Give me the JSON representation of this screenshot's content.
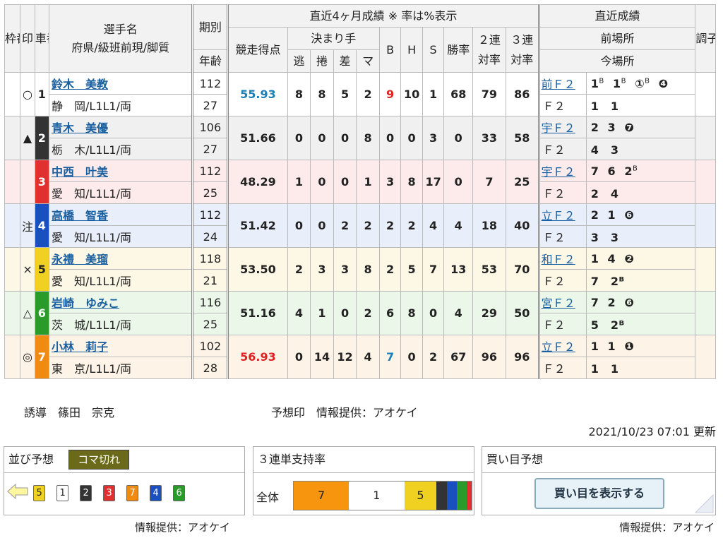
{
  "header": {
    "waku": "枠番",
    "shirushi": "印",
    "sha": "車番",
    "name1": "選手名",
    "name2": "府県/級班前現/脚質",
    "kibetsu": "期別",
    "nenrei": "年齢",
    "recent": "直近4ヶ月成績 ※ 率は%表示",
    "score": "競走得点",
    "kimari": "決まり手",
    "k_nige": "逃",
    "k_makuri": "捲",
    "k_sashi": "差",
    "k_ma": "マ",
    "b": "B",
    "h": "H",
    "s": "S",
    "win": "勝率",
    "ren2a": "２連",
    "ren2b": "対率",
    "ren3a": "３連",
    "ren3b": "対率",
    "latest": "直近成績",
    "prev": "前場所",
    "now": "今場所",
    "cho": "調子"
  },
  "riders": [
    {
      "waku": "1",
      "mark": "○",
      "name": "鈴木　美教",
      "pref": "静　岡/L1L1/両",
      "ki": "112",
      "age": "27",
      "score": "55.93",
      "nige": "8",
      "makuri": "8",
      "sashi": "5",
      "ma": "2",
      "b": "9",
      "h": "10",
      "s": "1",
      "win": "68",
      "r2": "79",
      "r3": "86",
      "prev_place": "前Ｆ２",
      "prev_res": [
        "1",
        "B",
        "1",
        "B",
        "①",
        "B",
        "❹"
      ],
      "now_place": "Ｆ２",
      "now_res": "1　1",
      "color": "#ffffff",
      "tcolor": "#222",
      "bg": "#ffffff"
    },
    {
      "waku": "2",
      "mark": "▲",
      "name": "青木　美優",
      "pref": "栃　木/L1L1/両",
      "ki": "106",
      "age": "27",
      "score": "51.66",
      "nige": "0",
      "makuri": "0",
      "sashi": "0",
      "ma": "8",
      "b": "0",
      "h": "0",
      "s": "3",
      "win": "0",
      "r2": "33",
      "r3": "58",
      "prev_place": "宇Ｆ２",
      "prev_res": [
        "2",
        "",
        "3",
        "",
        "❼",
        "",
        ""
      ],
      "now_place": "Ｆ２",
      "now_res": "4　3",
      "color": "#333333",
      "tcolor": "#fff",
      "bg": "#f0f0f0"
    },
    {
      "waku": "3",
      "mark": "",
      "name": "中西　叶美",
      "pref": "愛　知/L1L1/両",
      "ki": "112",
      "age": "25",
      "score": "48.29",
      "nige": "1",
      "makuri": "0",
      "sashi": "0",
      "ma": "1",
      "b": "3",
      "h": "8",
      "s": "17",
      "win": "0",
      "r2": "7",
      "r3": "25",
      "prev_place": "宇Ｆ２",
      "prev_res": [
        "7",
        "",
        "6",
        "",
        "2",
        "B",
        ""
      ],
      "now_place": "Ｆ２",
      "now_res": "2　4",
      "color": "#e03030",
      "tcolor": "#fff",
      "bg": "#fdeaea"
    },
    {
      "waku": "4",
      "mark": "注",
      "name": "高橋　智香",
      "pref": "愛　知/L1L1/両",
      "ki": "112",
      "age": "24",
      "score": "51.42",
      "nige": "0",
      "makuri": "0",
      "sashi": "2",
      "ma": "2",
      "b": "2",
      "h": "2",
      "s": "4",
      "win": "4",
      "r2": "18",
      "r3": "40",
      "prev_place": "立Ｆ２",
      "prev_res": [
        "2",
        "",
        "1",
        "",
        "❻",
        "",
        ""
      ],
      "now_place": "Ｆ２",
      "now_res": "3　3",
      "color": "#1a4fc0",
      "tcolor": "#fff",
      "bg": "#e8eefa"
    },
    {
      "waku": "5",
      "mark": "×",
      "name": "永禮　美瑠",
      "pref": "愛　知/L1L1/両",
      "ki": "118",
      "age": "21",
      "score": "53.50",
      "nige": "2",
      "makuri": "3",
      "sashi": "3",
      "ma": "8",
      "b": "2",
      "h": "5",
      "s": "7",
      "win": "13",
      "r2": "53",
      "r3": "70",
      "prev_place": "和Ｆ２",
      "prev_res": [
        "1",
        "",
        "4",
        "",
        "❷",
        "",
        ""
      ],
      "now_place": "Ｆ２",
      "now_res": "7　2ᴮ",
      "color": "#f0d020",
      "tcolor": "#222",
      "bg": "#fdf7e6"
    },
    {
      "waku": "6",
      "mark": "△",
      "name": "岩崎　ゆみこ",
      "pref": "茨　城/L1L1/両",
      "ki": "116",
      "age": "25",
      "score": "51.16",
      "nige": "4",
      "makuri": "1",
      "sashi": "0",
      "ma": "2",
      "b": "6",
      "h": "8",
      "s": "0",
      "win": "4",
      "r2": "29",
      "r3": "50",
      "prev_place": "宮Ｆ２",
      "prev_res": [
        "7",
        "",
        "2",
        "",
        "❻",
        "",
        ""
      ],
      "now_place": "Ｆ２",
      "now_res": "5　2ᴮ",
      "color": "#2a9a2a",
      "tcolor": "#fff",
      "bg": "#ebf7e8"
    },
    {
      "waku": "7",
      "mark": "◎",
      "name": "小林　莉子",
      "pref": "東　京/L1L1/両",
      "ki": "102",
      "age": "28",
      "score": "56.93",
      "nige": "0",
      "makuri": "14",
      "sashi": "12",
      "ma": "4",
      "b": "7",
      "h": "0",
      "s": "2",
      "win": "67",
      "r2": "96",
      "r3": "96",
      "prev_place": "立Ｆ２",
      "prev_res": [
        "1",
        "",
        "1",
        "",
        "❶",
        "",
        ""
      ],
      "now_place": "Ｆ２",
      "now_res": "1　1",
      "color": "#f08a10",
      "tcolor": "#fff",
      "bg": "#fdf3e6"
    }
  ],
  "info": {
    "yudo": "誘導　篠田　宗克",
    "yoso": "予想印　情報提供：アオケイ",
    "updated": "2021/10/23 07:01 更新"
  },
  "narabi": {
    "title": "並び予想",
    "tag": "コマ切れ",
    "order": [
      {
        "n": "5",
        "bg": "#f0d020",
        "fg": "#222"
      },
      {
        "n": "1",
        "bg": "#ffffff",
        "fg": "#222"
      },
      {
        "n": "2",
        "bg": "#333333",
        "fg": "#fff"
      },
      {
        "n": "3",
        "bg": "#e03030",
        "fg": "#fff"
      },
      {
        "n": "7",
        "bg": "#f08a10",
        "fg": "#fff"
      },
      {
        "n": "4",
        "bg": "#1a4fc0",
        "fg": "#fff"
      },
      {
        "n": "6",
        "bg": "#2a9a2a",
        "fg": "#fff"
      }
    ]
  },
  "support": {
    "title": "３連単支持率",
    "label": "全体",
    "segments": [
      {
        "n": "7",
        "frac": 0.325,
        "bg": "#f8950f"
      },
      {
        "n": "1",
        "frac": 0.325,
        "bg": "#ffffff"
      },
      {
        "n": "5",
        "frac": 0.19,
        "bg": "#f0d020"
      },
      {
        "n": "",
        "frac": 0.058,
        "bg": "#333333"
      },
      {
        "n": "",
        "frac": 0.058,
        "bg": "#1a4fc0"
      },
      {
        "n": "",
        "frac": 0.058,
        "bg": "#2a9a2a"
      },
      {
        "n": "",
        "frac": 0.029,
        "bg": "#e03030"
      }
    ]
  },
  "kaime": {
    "title": "買い目予想",
    "button": "買い目を表示する"
  },
  "footer": {
    "provider": "情報提供：アオケイ"
  }
}
